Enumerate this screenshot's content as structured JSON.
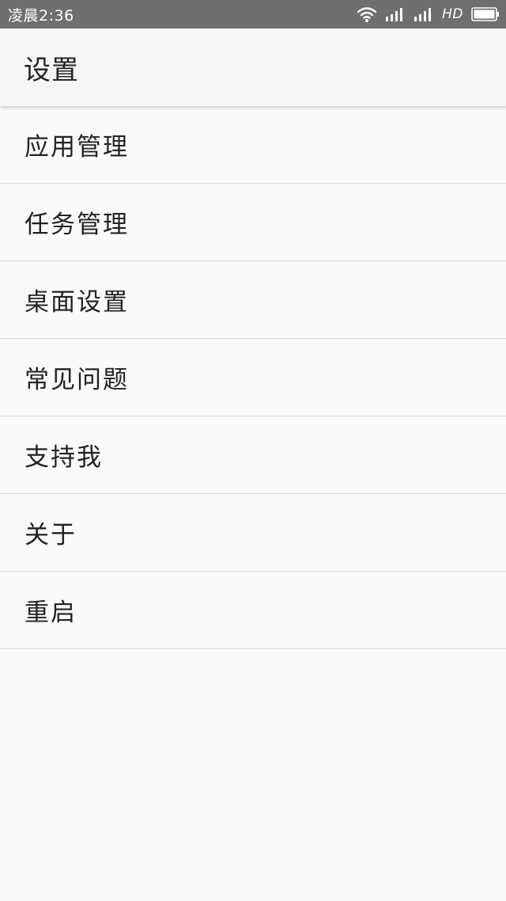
{
  "status_bar": {
    "time": "凌晨2:36",
    "network_label": "HD",
    "icons": [
      "wifi-icon",
      "signal-icon",
      "signal-icon",
      "battery-icon"
    ]
  },
  "app_bar": {
    "title": "设置"
  },
  "menu": {
    "items": [
      {
        "label": "应用管理"
      },
      {
        "label": "任务管理"
      },
      {
        "label": "桌面设置"
      },
      {
        "label": "常见问题"
      },
      {
        "label": "支持我"
      },
      {
        "label": "关于"
      },
      {
        "label": "重启"
      }
    ]
  },
  "colors": {
    "status_bar": "#6f6f6f",
    "app_bar": "#f5f5f5",
    "background": "#fafafa",
    "divider": "#d9d9d9",
    "text": "#222222"
  }
}
